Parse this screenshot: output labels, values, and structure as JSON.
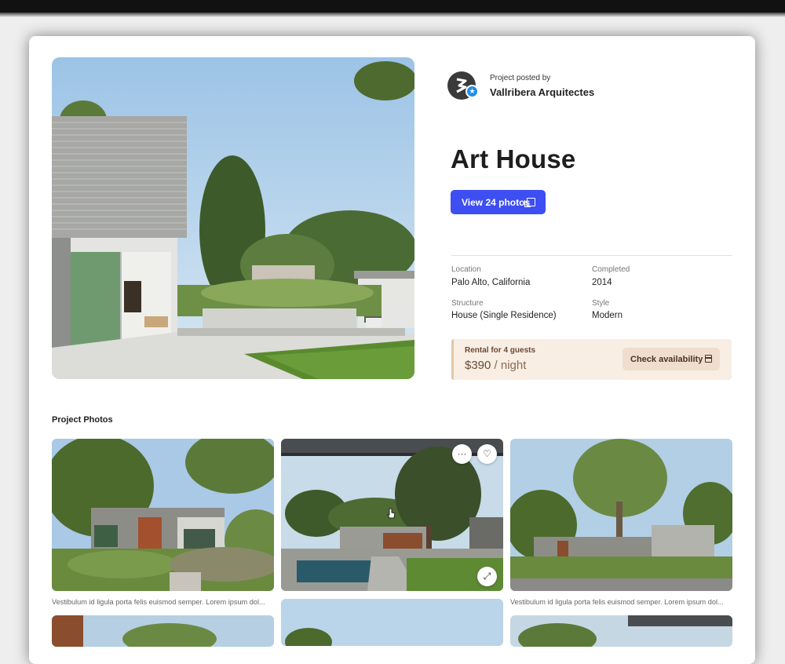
{
  "poster": {
    "posted_by_label": "Project posted by",
    "name": "Vallribera Arquitectes"
  },
  "project": {
    "title": "Art House",
    "view_photos_label": "View 24 photos"
  },
  "details": {
    "location_label": "Location",
    "location_value": "Palo Alto, California",
    "completed_label": "Completed",
    "completed_value": "2014",
    "structure_label": "Structure",
    "structure_value": "House (Single Residence)",
    "style_label": "Style",
    "style_value": "Modern"
  },
  "rental": {
    "label": "Rental for 4 guests",
    "price": "$390",
    "per": " / night",
    "check_label": "Check availability"
  },
  "photos_section": {
    "title": "Project Photos",
    "captions": [
      "Vestibulum id ligula porta felis euismod semper. Lorem ipsum dol...",
      "Vestibulum id ligula porta felis euismod semper. Lorem ipsum dol..."
    ],
    "more_glyph": "···",
    "like_glyph": "♡",
    "expand_glyph": "⤢"
  },
  "colors": {
    "primary_button": "#3d4ef2",
    "rental_bg": "#f8eee4",
    "verified_badge": "#1e8fe6"
  },
  "icons": [
    "verified-star-icon",
    "copy-icon",
    "calendar-icon",
    "more-icon",
    "heart-icon",
    "expand-icon",
    "cursor-icon"
  ]
}
